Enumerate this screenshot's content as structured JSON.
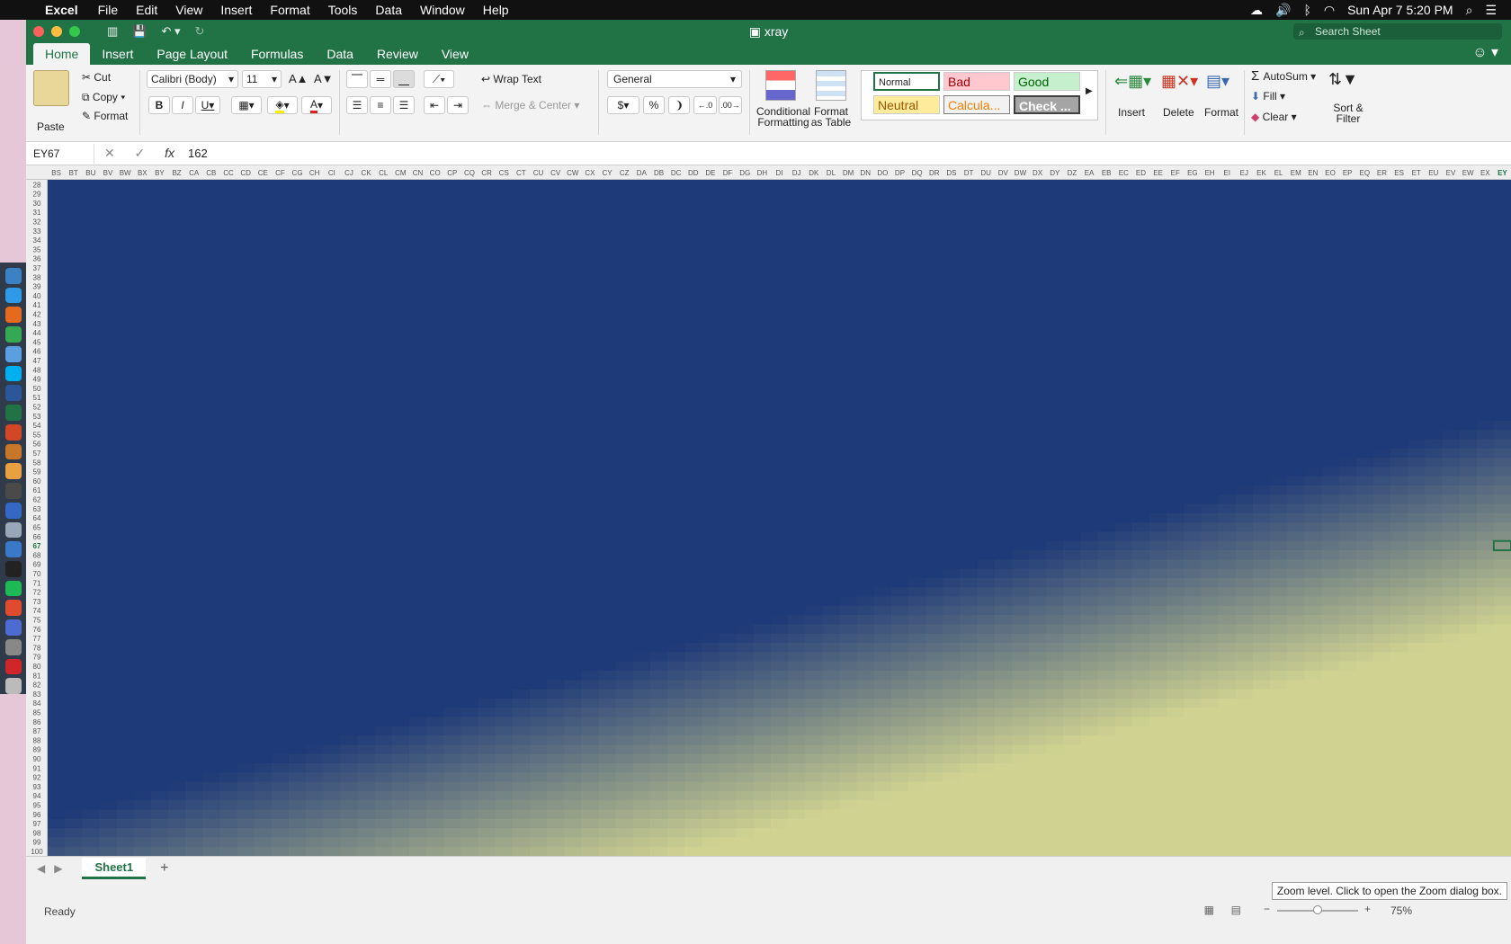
{
  "menubar": {
    "app": "Excel",
    "items": [
      "File",
      "Edit",
      "View",
      "Insert",
      "Format",
      "Tools",
      "Data",
      "Window",
      "Help"
    ],
    "clock": "Sun Apr 7  5:20 PM"
  },
  "window": {
    "title": "xray",
    "search_placeholder": "Search Sheet"
  },
  "tabs": [
    "Home",
    "Insert",
    "Page Layout",
    "Formulas",
    "Data",
    "Review",
    "View"
  ],
  "ribbon": {
    "paste": "Paste",
    "cut": "Cut",
    "copy": "Copy",
    "format_painter": "Format",
    "font_name": "Calibri (Body)",
    "font_size": "11",
    "wrap_text": "Wrap Text",
    "merge_center": "Merge & Center",
    "number_format": "General",
    "conditional_formatting_1": "Conditional",
    "conditional_formatting_2": "Formatting",
    "format_table_1": "Format",
    "format_table_2": "as Table",
    "styles": {
      "normal": "Normal",
      "bad": "Bad",
      "good": "Good",
      "neutral": "Neutral",
      "calculation": "Calcula...",
      "check": "Check ..."
    },
    "insert": "Insert",
    "delete": "Delete",
    "format": "Format",
    "autosum": "AutoSum",
    "fill": "Fill",
    "clear": "Clear",
    "sort_filter_1": "Sort &",
    "sort_filter_2": "Filter",
    "colors": {
      "bad_bg": "#ffc7ce",
      "bad_fg": "#9c0006",
      "good_bg": "#c6efce",
      "good_fg": "#006100",
      "neutral_bg": "#ffeb9c",
      "neutral_fg": "#9c5700",
      "calc_bg": "#f2f2f2",
      "calc_fg": "#fa7d00",
      "check_bg": "#a5a5a5",
      "check_fg": "#ffffff"
    }
  },
  "formula_bar": {
    "name_box": "EY67",
    "formula": "162"
  },
  "sheet": {
    "column_headers": [
      "BS",
      "BT",
      "BU",
      "BV",
      "BW",
      "BX",
      "BY",
      "BZ",
      "CA",
      "CB",
      "CC",
      "CD",
      "CE",
      "CF",
      "CG",
      "CH",
      "CI",
      "CJ",
      "CK",
      "CL",
      "CM",
      "CN",
      "CO",
      "CP",
      "CQ",
      "CR",
      "CS",
      "CT",
      "CU",
      "CV",
      "CW",
      "CX",
      "CY",
      "CZ",
      "DA",
      "DB",
      "DC",
      "DD",
      "DE",
      "DF",
      "DG",
      "DH",
      "DI",
      "DJ",
      "DK",
      "DL",
      "DM",
      "DN",
      "DO",
      "DP",
      "DQ",
      "DR",
      "DS",
      "DT",
      "DU",
      "DV",
      "DW",
      "DX",
      "DY",
      "DZ",
      "EA",
      "EB",
      "EC",
      "ED",
      "EE",
      "EF",
      "EG",
      "EH",
      "EI",
      "EJ",
      "EK",
      "EL",
      "EM",
      "EN",
      "EO",
      "EP",
      "EQ",
      "ER",
      "ES",
      "ET",
      "EU",
      "EV",
      "EW",
      "EX",
      "EY"
    ],
    "first_row": 28,
    "last_row": 100,
    "active_row": 67,
    "active_col": "EY",
    "tabs": [
      "Sheet1"
    ]
  },
  "status": {
    "ready": "Ready",
    "zoom": "75%",
    "zoom_tooltip": "Zoom level. Click to open the Zoom dialog box."
  },
  "palette": {
    "excel_green": "#217346",
    "low": "#1f3a78",
    "high": "#cfd291"
  }
}
